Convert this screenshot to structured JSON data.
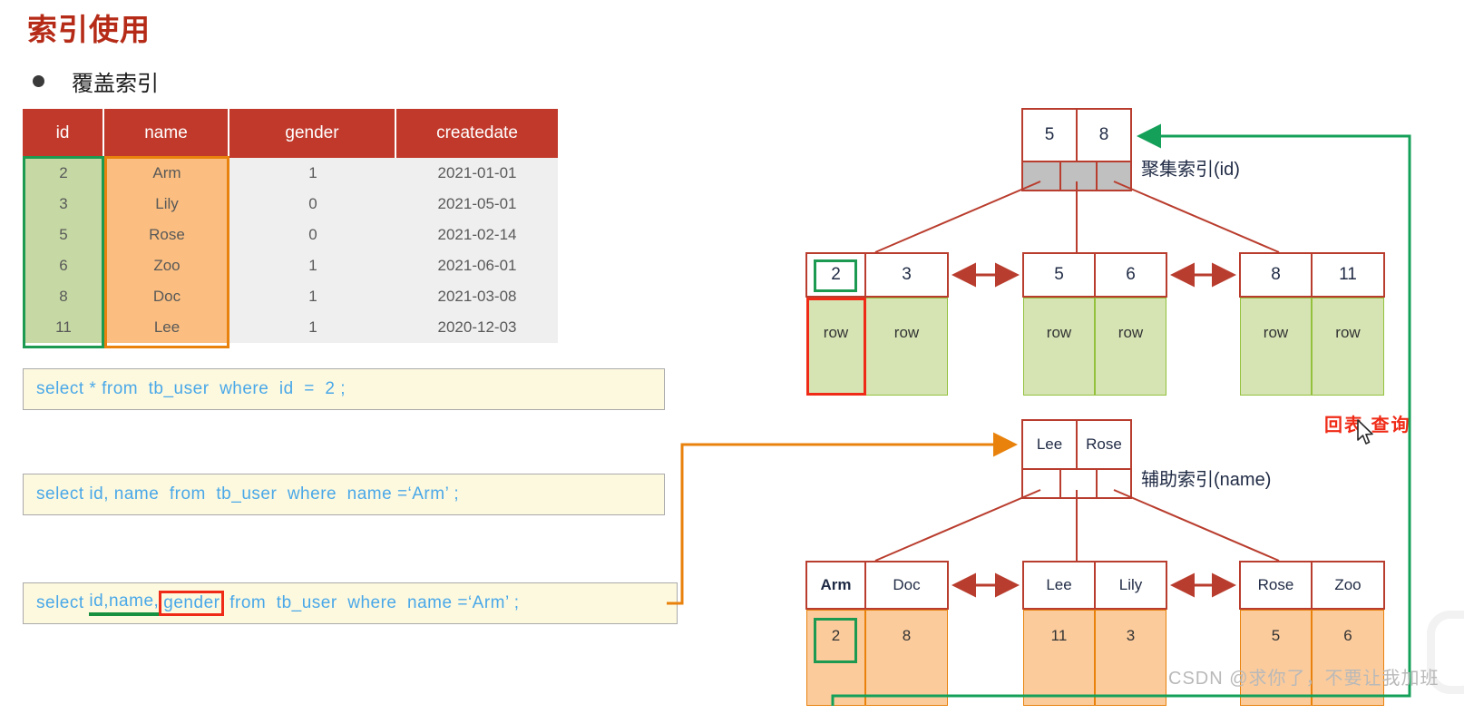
{
  "page": {
    "title": "索引使用",
    "bullet": "覆盖索引"
  },
  "table": {
    "headers": [
      "id",
      "name",
      "gender",
      "createdate"
    ],
    "rows": [
      {
        "id": "2",
        "name": "Arm",
        "gender": "1",
        "createdate": "2021-01-01"
      },
      {
        "id": "3",
        "name": "Lily",
        "gender": "0",
        "createdate": "2021-05-01"
      },
      {
        "id": "5",
        "name": "Rose",
        "gender": "0",
        "createdate": "2021-02-14"
      },
      {
        "id": "6",
        "name": "Zoo",
        "gender": "1",
        "createdate": "2021-06-01"
      },
      {
        "id": "8",
        "name": "Doc",
        "gender": "1",
        "createdate": "2021-03-08"
      },
      {
        "id": "11",
        "name": "Lee",
        "gender": "1",
        "createdate": "2020-12-03"
      }
    ]
  },
  "sql": {
    "stmt1": "select * from  tb_user  where  id  =  2 ;",
    "stmt2": "select id, name  from  tb_user  where  name =‘Arm’ ;",
    "stmt3_pre": "select ",
    "stmt3_underlined": "id,name,",
    "stmt3_boxed": "gender",
    "stmt3_post": " from  tb_user  where  name =‘Arm’ ;"
  },
  "clustered": {
    "label": "聚集索引(id)",
    "root": [
      "5",
      "8"
    ],
    "leaves": [
      {
        "keys": [
          "2",
          "3"
        ],
        "payload": [
          "row",
          "row"
        ]
      },
      {
        "keys": [
          "5",
          "6"
        ],
        "payload": [
          "row",
          "row"
        ]
      },
      {
        "keys": [
          "8",
          "11"
        ],
        "payload": [
          "row",
          "row"
        ]
      }
    ]
  },
  "secondary": {
    "label": "辅助索引(name)",
    "root": [
      "Lee",
      "Rose"
    ],
    "leaves": [
      {
        "keys": [
          "Arm",
          "Doc"
        ],
        "payload": [
          "2",
          "8"
        ]
      },
      {
        "keys": [
          "Lee",
          "Lily"
        ],
        "payload": [
          "11",
          "3"
        ]
      },
      {
        "keys": [
          "Rose",
          "Zoo"
        ],
        "payload": [
          "5",
          "6"
        ]
      }
    ]
  },
  "annotations": {
    "back_to_table": "回表 查询",
    "watermark": "CSDN @求你了，不要让我加班"
  },
  "colors": {
    "title_red": "#b52b17",
    "header_red": "#c0392b",
    "id_green_fill": "#c6d9a4",
    "name_orange_fill": "#fbbe80",
    "node_border": "#b93d2e",
    "green_path": "#15a05a",
    "orange_path": "#e8820c",
    "highlight_red": "#ef2b17",
    "highlight_green": "#1d9a52",
    "sql_text": "#4aa8e8",
    "sql_bg": "#fdf9df"
  }
}
